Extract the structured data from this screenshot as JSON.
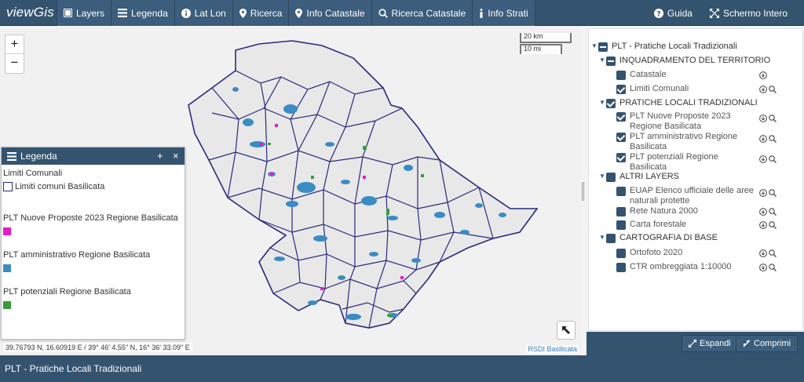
{
  "app": {
    "brand": "viewGis"
  },
  "nav": {
    "items": [
      {
        "label": "Layers",
        "icon": "layers-icon"
      },
      {
        "label": "Legenda",
        "icon": "list-icon"
      },
      {
        "label": "Lat Lon",
        "icon": "info-circle-icon"
      },
      {
        "label": "Ricerca",
        "icon": "map-marker-icon"
      },
      {
        "label": "Info Catastale",
        "icon": "map-marker-icon"
      },
      {
        "label": "Ricerca Catastale",
        "icon": "search-icon"
      },
      {
        "label": "Info Strati",
        "icon": "info-icon"
      }
    ],
    "right": [
      {
        "label": "Guida",
        "icon": "question-circle-icon"
      },
      {
        "label": "Schermo Intero",
        "icon": "fullscreen-icon"
      }
    ]
  },
  "map": {
    "zoom_in": "+",
    "zoom_out": "−",
    "scale_km": "20 km",
    "scale_mi": "10 mi",
    "coordinates": "39.76793 N, 16.60919 E / 39° 46' 4.55\" N, 16° 36' 33.09\" E",
    "attribution": "RSDI Basilicata"
  },
  "legend": {
    "title": "Legenda",
    "add": "+",
    "close": "×",
    "groups": [
      {
        "title": "Limiti Comunali",
        "entry": "Limiti comuni Basilicata",
        "style": "outline",
        "color": "#2a2a80"
      },
      {
        "title": "PLT Nuove Proposte 2023 Regione Basilicata",
        "style": "fill",
        "color": "#e61dc8"
      },
      {
        "title": "PLT amministrativo Regione Basilicata",
        "style": "fill",
        "color": "#3a8cc2"
      },
      {
        "title": "PLT potenziali Regione Basilicata",
        "style": "fill",
        "color": "#3a9b3a"
      }
    ]
  },
  "tree": {
    "root": "PLT - Pratiche Locali Tradizionali",
    "groups": [
      {
        "label": "INQUADRAMENTO DEL TERRITORIO",
        "state": "partial",
        "children": [
          {
            "label": "Catastale",
            "checked": false,
            "zoom": false
          },
          {
            "label": "Limiti Comunali",
            "checked": true,
            "zoom": true
          }
        ]
      },
      {
        "label": "PRATICHE LOCALI TRADIZIONALI",
        "state": "checked",
        "children": [
          {
            "label1": "PLT Nuove Proposte 2023",
            "label2": "Regione Basilicata",
            "checked": true,
            "zoom": true
          },
          {
            "label1": "PLT amministrativo Regione",
            "label2": "Basilicata",
            "checked": true,
            "zoom": true
          },
          {
            "label1": "PLT potenziali Regione",
            "label2": "Basilicata",
            "checked": true,
            "zoom": true
          }
        ]
      },
      {
        "label": "ALTRI LAYERS",
        "state": "none",
        "children": [
          {
            "label1": "EUAP Elenco ufficiale delle aree",
            "label2": "naturali protette",
            "checked": false,
            "zoom": true
          },
          {
            "label": "Rete Natura 2000",
            "checked": false,
            "zoom": true
          },
          {
            "label": "Carta forestale",
            "checked": false,
            "zoom": true
          }
        ]
      },
      {
        "label": "CARTOGRAFIA DI BASE",
        "state": "none",
        "children": [
          {
            "label": "Ortofoto 2020",
            "checked": false,
            "zoom": true
          },
          {
            "label": "CTR ombreggiata 1:10000",
            "checked": false,
            "zoom": true
          }
        ]
      }
    ]
  },
  "panel_footer": {
    "expand": "Espandi",
    "collapse": "Comprimi"
  },
  "footer": {
    "title": "PLT - Pratiche Locali Tradizionali"
  },
  "colors": {
    "header": "#34536f",
    "accent": "#2b5d92",
    "boundaries": "#2a2a80"
  }
}
